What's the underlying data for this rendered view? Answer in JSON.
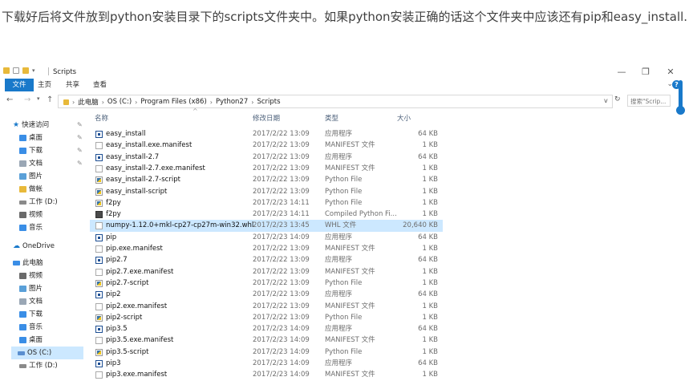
{
  "article": {
    "text": "下载好后将文件放到python安装目录下的scripts文件夹中。如果python安装正确的话这个文件夹中应该还有pip和easy_install."
  },
  "window": {
    "title": "Scripts",
    "minimize": "—",
    "maximize": "❐",
    "close": "✕"
  },
  "ribbon": {
    "file": "文件",
    "home": "主页",
    "share": "共享",
    "view": "查看",
    "help": "?"
  },
  "address": {
    "root": "此电脑",
    "drive": "OS (C:)",
    "pf": "Program Files (x86)",
    "py": "Python27",
    "scripts": "Scripts",
    "search_placeholder": "搜索\"Scrip...",
    "refresh": "↻",
    "dropdown": "v"
  },
  "sidebar": {
    "quick_access": "快速访问",
    "desktop": "桌面",
    "downloads": "下载",
    "documents": "文档",
    "pictures": "图片",
    "bangzhang": "做帐",
    "work_d": "工作 (D:)",
    "videos": "视频",
    "music": "音乐",
    "onedrive": "OneDrive",
    "this_pc": "此电脑",
    "pc_videos": "视频",
    "pc_pictures": "图片",
    "pc_documents": "文档",
    "pc_downloads": "下载",
    "pc_music": "音乐",
    "pc_desktop": "桌面",
    "os_c": "OS (C:)",
    "work_d2": "工作 (D:)"
  },
  "columns": {
    "name": "名称",
    "date": "修改日期",
    "type": "类型",
    "size": "大小"
  },
  "colors": {
    "accent": "#1979ca",
    "selection": "#cce8ff"
  },
  "files": [
    {
      "name": "easy_install",
      "date": "2017/2/22 13:09",
      "type": "应用程序",
      "size": "64 KB",
      "icon": "exe"
    },
    {
      "name": "easy_install.exe.manifest",
      "date": "2017/2/22 13:09",
      "type": "MANIFEST 文件",
      "size": "1 KB",
      "icon": "doc"
    },
    {
      "name": "easy_install-2.7",
      "date": "2017/2/22 13:09",
      "type": "应用程序",
      "size": "64 KB",
      "icon": "exe"
    },
    {
      "name": "easy_install-2.7.exe.manifest",
      "date": "2017/2/22 13:09",
      "type": "MANIFEST 文件",
      "size": "1 KB",
      "icon": "doc"
    },
    {
      "name": "easy_install-2.7-script",
      "date": "2017/2/22 13:09",
      "type": "Python File",
      "size": "1 KB",
      "icon": "py"
    },
    {
      "name": "easy_install-script",
      "date": "2017/2/22 13:09",
      "type": "Python File",
      "size": "1 KB",
      "icon": "py"
    },
    {
      "name": "f2py",
      "date": "2017/2/23 14:11",
      "type": "Python File",
      "size": "1 KB",
      "icon": "py"
    },
    {
      "name": "f2py",
      "date": "2017/2/23 14:11",
      "type": "Compiled Python Fi...",
      "size": "1 KB",
      "icon": "pyc"
    },
    {
      "name": "numpy-1.12.0+mkl-cp27-cp27m-win32.whl",
      "date": "2017/2/23 13:45",
      "type": "WHL 文件",
      "size": "20,640 KB",
      "icon": "whl",
      "selected": true
    },
    {
      "name": "pip",
      "date": "2017/2/23 14:09",
      "type": "应用程序",
      "size": "64 KB",
      "icon": "exe"
    },
    {
      "name": "pip.exe.manifest",
      "date": "2017/2/22 13:09",
      "type": "MANIFEST 文件",
      "size": "1 KB",
      "icon": "doc"
    },
    {
      "name": "pip2.7",
      "date": "2017/2/22 13:09",
      "type": "应用程序",
      "size": "64 KB",
      "icon": "exe"
    },
    {
      "name": "pip2.7.exe.manifest",
      "date": "2017/2/22 13:09",
      "type": "MANIFEST 文件",
      "size": "1 KB",
      "icon": "doc"
    },
    {
      "name": "pip2.7-script",
      "date": "2017/2/22 13:09",
      "type": "Python File",
      "size": "1 KB",
      "icon": "py"
    },
    {
      "name": "pip2",
      "date": "2017/2/22 13:09",
      "type": "应用程序",
      "size": "64 KB",
      "icon": "exe"
    },
    {
      "name": "pip2.exe.manifest",
      "date": "2017/2/22 13:09",
      "type": "MANIFEST 文件",
      "size": "1 KB",
      "icon": "doc"
    },
    {
      "name": "pip2-script",
      "date": "2017/2/22 13:09",
      "type": "Python File",
      "size": "1 KB",
      "icon": "py"
    },
    {
      "name": "pip3.5",
      "date": "2017/2/23 14:09",
      "type": "应用程序",
      "size": "64 KB",
      "icon": "exe"
    },
    {
      "name": "pip3.5.exe.manifest",
      "date": "2017/2/23 14:09",
      "type": "MANIFEST 文件",
      "size": "1 KB",
      "icon": "doc"
    },
    {
      "name": "pip3.5-script",
      "date": "2017/2/23 14:09",
      "type": "Python File",
      "size": "1 KB",
      "icon": "py"
    },
    {
      "name": "pip3",
      "date": "2017/2/23 14:09",
      "type": "应用程序",
      "size": "64 KB",
      "icon": "exe"
    },
    {
      "name": "pip3.exe.manifest",
      "date": "2017/2/23 14:09",
      "type": "MANIFEST 文件",
      "size": "1 KB",
      "icon": "doc"
    }
  ]
}
